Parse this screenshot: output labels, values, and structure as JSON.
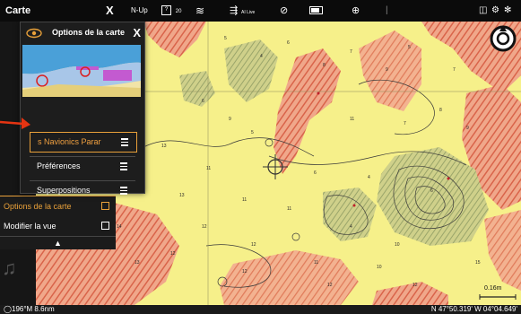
{
  "topbar": {
    "title": "Carte",
    "close_symbol": "X",
    "orientation": "N-Up",
    "page_count": "20",
    "ai_live": "AI Live"
  },
  "options_panel": {
    "title": "Options de la carte",
    "close_symbol": "X",
    "items": [
      {
        "label": "s Navionics   Parar",
        "state": "selected"
      },
      {
        "label": "Préférences"
      },
      {
        "label": "Superpositions"
      }
    ]
  },
  "lower_menu": {
    "items": [
      {
        "label": "Options de la carte",
        "state": "selected"
      },
      {
        "label": "Modifier la vue"
      }
    ],
    "chevron": "▲"
  },
  "status": {
    "heading": "196°M 8.6nm",
    "coordinates": "N 47°50.319' W 04°04.649'",
    "scale": "0.16m"
  },
  "colors": {
    "accent": "#e9a13a",
    "map_yellow": "#f6f08a",
    "hatch_red": "#d9644a",
    "hatch_green": "#9aa56a",
    "panel_bg": "#1d1d1d",
    "callout": "#e53412"
  },
  "icons": {
    "options_header": "eye-icon",
    "menu_items": "menu-lines-icon",
    "lower_items": "square-icon",
    "compass": "compass-icon",
    "map_center": "crosshair-icon"
  }
}
